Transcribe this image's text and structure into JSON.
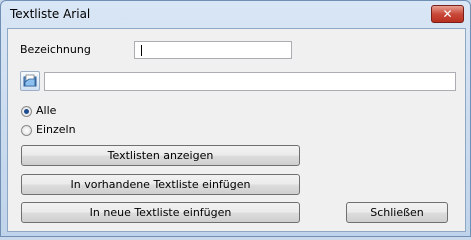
{
  "window": {
    "title": "Textliste  Arial",
    "close_glyph": "✕"
  },
  "form": {
    "bezeichnung_label": "Bezeichnung",
    "bezeichnung_value": "",
    "path_value": ""
  },
  "radios": {
    "alle": {
      "label": "Alle",
      "selected": true
    },
    "einzeln": {
      "label": "Einzeln",
      "selected": false
    }
  },
  "buttons": {
    "show_lists": "Textlisten anzeigen",
    "insert_existing": "In vorhandene Textliste einfügen",
    "insert_new": "In neue Textliste einfügen",
    "close": "Schließen"
  },
  "icons": {
    "browse": "folder-browse-icon"
  }
}
